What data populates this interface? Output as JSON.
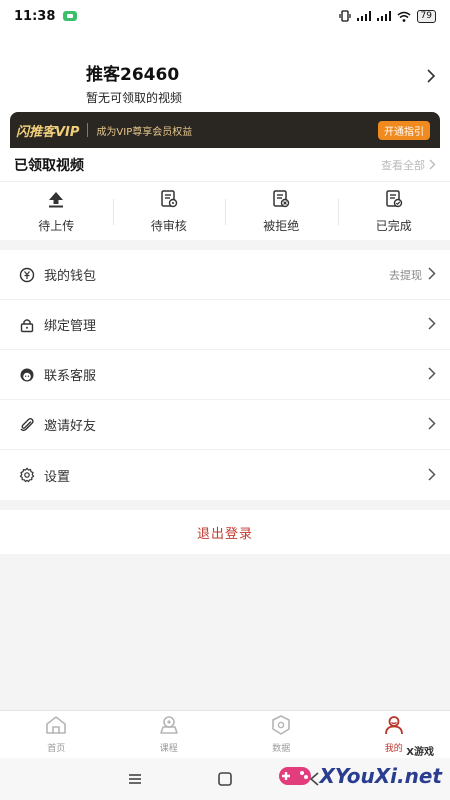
{
  "status_bar": {
    "time": "11:38",
    "battery": "79",
    "icons": [
      "chat-app-icon",
      "vibrate-icon",
      "signal-icon",
      "signal-icon",
      "wifi-icon",
      "battery-icon"
    ]
  },
  "profile": {
    "name": "推客26460",
    "subtitle": "暂无可领取的视频"
  },
  "vip": {
    "title": "闪推客VIP",
    "desc": "成为VIP尊享会员权益",
    "button": "开通指引",
    "accent": "#f08a1e"
  },
  "videos": {
    "title": "已领取视频",
    "view_all": "查看全部",
    "tabs": [
      {
        "label": "待上传",
        "icon": "upload-icon"
      },
      {
        "label": "待审核",
        "icon": "review-icon"
      },
      {
        "label": "被拒绝",
        "icon": "rejected-icon"
      },
      {
        "label": "已完成",
        "icon": "completed-icon"
      }
    ]
  },
  "menu": {
    "items": [
      {
        "label": "我的钱包",
        "value": "去提现",
        "icon": "wallet-icon"
      },
      {
        "label": "绑定管理",
        "value": "",
        "icon": "lock-icon"
      },
      {
        "label": "联系客服",
        "value": "",
        "icon": "customer-service-icon"
      },
      {
        "label": "邀请好友",
        "value": "",
        "icon": "paperclip-icon"
      },
      {
        "label": "设置",
        "value": "",
        "icon": "settings-icon"
      }
    ]
  },
  "logout": {
    "label": "退出登录",
    "color": "#c23b2f"
  },
  "tabbar": {
    "items": [
      {
        "label": "首页",
        "icon": "home-icon"
      },
      {
        "label": "课程",
        "icon": "course-icon"
      },
      {
        "label": "数据",
        "icon": "data-icon"
      },
      {
        "label": "我的",
        "icon": "profile-icon"
      }
    ],
    "active": "我的"
  },
  "watermark": {
    "text": "XYouXi.net",
    "small": "X游戏"
  }
}
